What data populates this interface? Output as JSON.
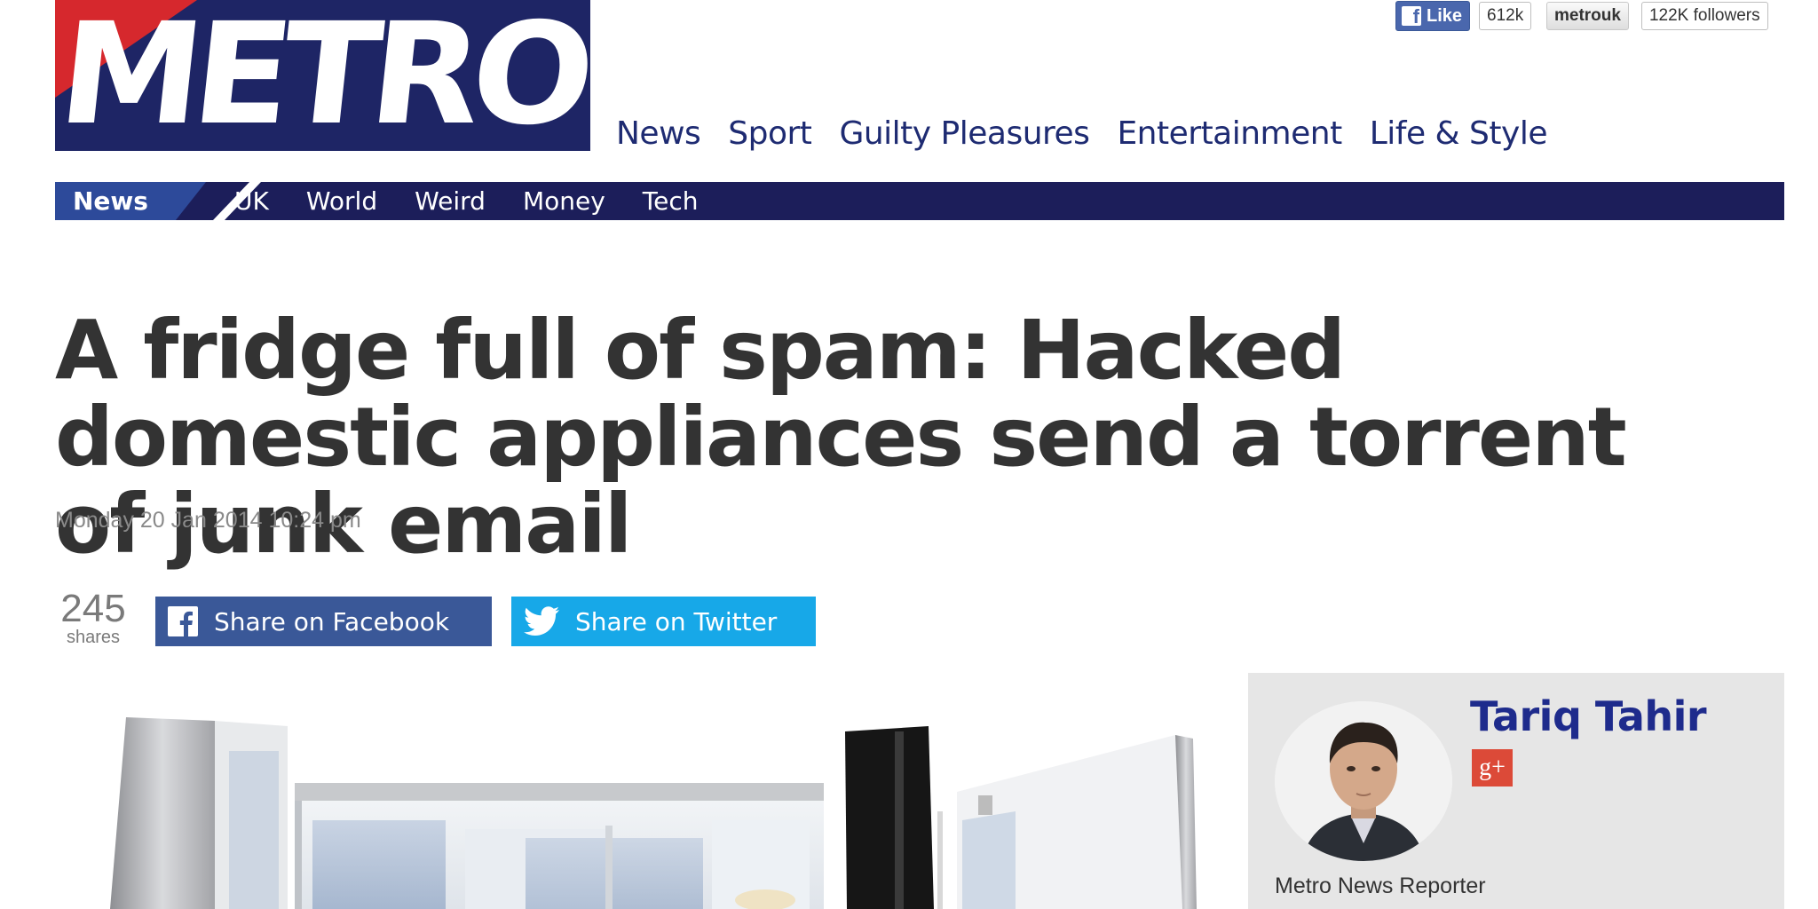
{
  "brand": {
    "logo_text": "METRO",
    "navy": "#1e2565",
    "red": "#d6282d"
  },
  "social": {
    "facebook": {
      "like_label": "Like",
      "like_count": "612k"
    },
    "twitter": {
      "handle": "metrouk",
      "followers": "122K followers"
    }
  },
  "main_nav": {
    "items": [
      {
        "label": "News"
      },
      {
        "label": "Sport"
      },
      {
        "label": "Guilty Pleasures"
      },
      {
        "label": "Entertainment"
      },
      {
        "label": "Life & Style"
      }
    ]
  },
  "sub_nav": {
    "active": "News",
    "items": [
      {
        "label": "UK"
      },
      {
        "label": "World"
      },
      {
        "label": "Weird"
      },
      {
        "label": "Money"
      },
      {
        "label": "Tech"
      }
    ]
  },
  "article": {
    "headline": "A fridge full of spam: Hacked domestic appliances send a torrent of junk email",
    "date": "Monday 20 Jan 2014 10:24 pm"
  },
  "share": {
    "count": "245",
    "count_label": "shares",
    "facebook_label": "Share on Facebook",
    "twitter_label": "Share on Twitter",
    "facebook_color": "#3a5898",
    "twitter_color": "#17a8e8"
  },
  "author": {
    "name": "Tariq Tahir",
    "gplus_label": "g+",
    "role": "Metro News Reporter"
  }
}
